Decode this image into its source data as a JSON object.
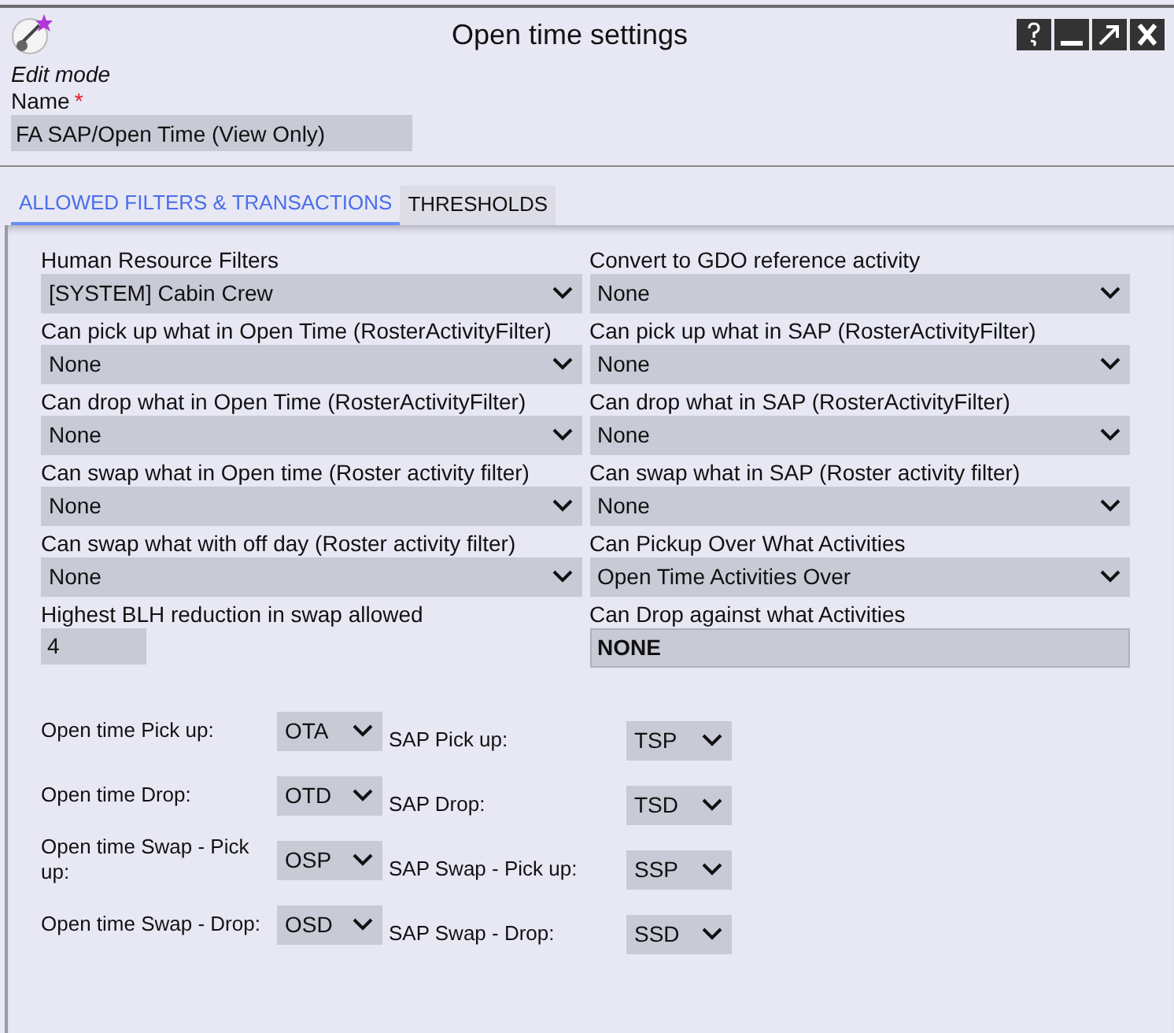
{
  "window": {
    "title": "Open time settings"
  },
  "mode": "Edit mode",
  "name_field": {
    "label": "Name",
    "required_mark": "*",
    "value": "FA SAP/Open Time (View Only)"
  },
  "tabs": [
    {
      "label": "ALLOWED FILTERS & TRANSACTIONS",
      "selected": true
    },
    {
      "label": "THRESHOLDS",
      "selected": false
    }
  ],
  "fields": [
    {
      "label": "Human Resource Filters",
      "kind": "select",
      "value": "[SYSTEM] Cabin Crew"
    },
    {
      "label": "Convert to GDO reference activity",
      "kind": "select",
      "value": "None"
    },
    {
      "label": "Can pick up what in Open Time (RosterActivityFilter)",
      "kind": "select",
      "value": "None"
    },
    {
      "label": "Can pick up what in SAP (RosterActivityFilter)",
      "kind": "select",
      "value": "None"
    },
    {
      "label": "Can drop what in Open Time (RosterActivityFilter)",
      "kind": "select",
      "value": "None"
    },
    {
      "label": "Can drop what in SAP (RosterActivityFilter)",
      "kind": "select",
      "value": "None"
    },
    {
      "label": "Can swap what in Open time (Roster activity filter)",
      "kind": "select",
      "value": "None"
    },
    {
      "label": "Can swap what in SAP (Roster activity filter)",
      "kind": "select",
      "value": "None"
    },
    {
      "label": "Can swap what with off day (Roster activity filter)",
      "kind": "select",
      "value": "None"
    },
    {
      "label": "Can Pickup Over What Activities",
      "kind": "select",
      "value": "Open Time Activities Over"
    },
    {
      "label": "Highest BLH reduction in swap allowed",
      "kind": "number",
      "value": "4"
    },
    {
      "label": "Can Drop against what Activities",
      "kind": "readonly",
      "value": "NONE"
    }
  ],
  "codes_left": [
    {
      "label": "Open time Pick up:",
      "value": "OTA"
    },
    {
      "label": "Open time Drop:",
      "value": "OTD"
    },
    {
      "label": "Open time Swap - Pick up:",
      "value": "OSP"
    },
    {
      "label": "Open time Swap - Drop:",
      "value": "OSD"
    }
  ],
  "codes_right": [
    {
      "label": "SAP Pick up:",
      "value": "TSP"
    },
    {
      "label": "SAP Drop:",
      "value": "TSD"
    },
    {
      "label": "SAP Swap - Pick up:",
      "value": "SSP"
    },
    {
      "label": "SAP Swap - Drop:",
      "value": "SSD"
    }
  ]
}
